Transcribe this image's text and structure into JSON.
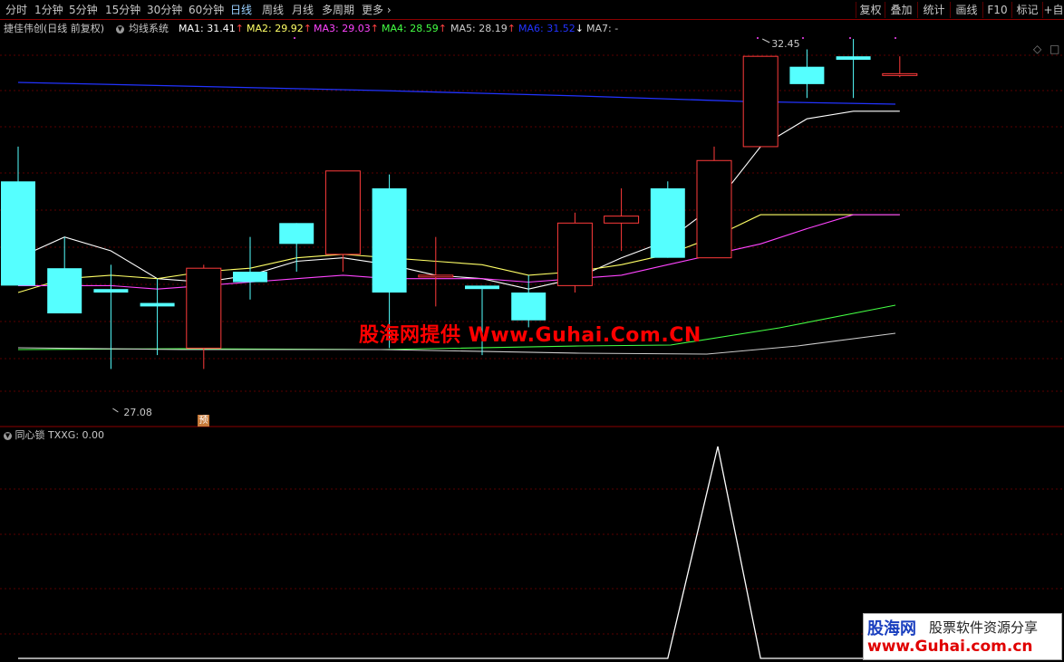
{
  "periods": [
    "分时",
    "1分钟",
    "5分钟",
    "15分钟",
    "30分钟",
    "60分钟",
    "日线",
    "周线",
    "月线",
    "多周期",
    "更多 ›"
  ],
  "active_period": "日线",
  "tools": [
    "复权",
    "叠加",
    "统计",
    "画线",
    "F10",
    "标记",
    "+自"
  ],
  "stock_name": "捷佳伟创(日线 前复权)",
  "indicator_name": "均线系统",
  "ma": [
    {
      "label": "MA1: 31.41",
      "color": "#ffffff",
      "arrow": "↑"
    },
    {
      "label": "MA2: 29.92",
      "color": "#ffff66",
      "arrow": "↑"
    },
    {
      "label": "MA3: 29.03",
      "color": "#ff44ff",
      "arrow": "↑"
    },
    {
      "label": "MA4: 28.59",
      "color": "#44ff44",
      "arrow": "↑"
    },
    {
      "label": "MA5: 28.19",
      "color": "#cccccc",
      "arrow": "↑"
    },
    {
      "label": "MA6: 31.52",
      "color": "#2233ff",
      "arrow": "↓"
    },
    {
      "label": "MA7: -",
      "color": "#cccccc",
      "arrow": ""
    }
  ],
  "price_high_label": "32.45",
  "price_low_label": "27.08",
  "pre_badge": "预",
  "sub_indicator": "同心锁",
  "sub_value": "TXXG: 0.00",
  "watermark": "股海网提供 Www.Guhai.Com.CN",
  "logo": {
    "main": "股海网",
    "slogan": "股票软件资源分享",
    "url": "www.Guhai.com.cn"
  },
  "icons": {
    "diamond": "◇",
    "close": "□",
    "collapse": "▼"
  },
  "colors": {
    "up": "#ff3b3b",
    "down": "#55ffff",
    "grid": "#5a0000",
    "border": "#8b0000"
  },
  "chart_data": {
    "type": "candlestick",
    "candles": [
      {
        "o": 30.4,
        "h": 30.9,
        "l": 28.9,
        "c": 28.9
      },
      {
        "o": 29.15,
        "h": 29.6,
        "l": 28.6,
        "c": 28.5
      },
      {
        "o": 28.85,
        "h": 29.2,
        "l": 27.7,
        "c": 28.8
      },
      {
        "o": 28.65,
        "h": 29.0,
        "l": 27.9,
        "c": 28.6
      },
      {
        "o": 28.0,
        "h": 29.2,
        "l": 27.7,
        "c": 29.15
      },
      {
        "o": 29.1,
        "h": 29.6,
        "l": 28.7,
        "c": 28.95
      },
      {
        "o": 29.8,
        "h": 29.6,
        "l": 29.1,
        "c": 29.5
      },
      {
        "o": 29.35,
        "h": 30.1,
        "l": 29.1,
        "c": 30.55
      },
      {
        "o": 30.3,
        "h": 30.5,
        "l": 28.0,
        "c": 28.8
      },
      {
        "o": 29.05,
        "h": 29.6,
        "l": 28.6,
        "c": 29.05
      },
      {
        "o": 28.9,
        "h": 28.8,
        "l": 27.9,
        "c": 28.85
      },
      {
        "o": 28.8,
        "h": 29.05,
        "l": 28.3,
        "c": 28.4
      },
      {
        "o": 28.9,
        "h": 29.95,
        "l": 28.8,
        "c": 29.8
      },
      {
        "o": 29.8,
        "h": 30.3,
        "l": 29.4,
        "c": 29.9
      },
      {
        "o": 30.3,
        "h": 30.4,
        "l": 29.3,
        "c": 29.3
      },
      {
        "o": 29.3,
        "h": 30.9,
        "l": 29.3,
        "c": 30.7
      },
      {
        "o": 30.9,
        "h": 32.2,
        "l": 30.9,
        "c": 32.2
      },
      {
        "o": 32.05,
        "h": 32.3,
        "l": 31.6,
        "c": 31.8
      },
      {
        "o": 32.2,
        "h": 32.45,
        "l": 31.6,
        "c": 32.15
      },
      {
        "o": 31.95,
        "h": 32.2,
        "l": 31.9,
        "c": 31.95
      }
    ],
    "ma_lines": [
      {
        "name": "MA1",
        "values": [
          29.3,
          29.6,
          29.4,
          29.0,
          28.95,
          29.05,
          29.25,
          29.3,
          29.2,
          29.05,
          29.0,
          28.85,
          29.0,
          29.3,
          29.55,
          30.05,
          30.9,
          31.3,
          31.41,
          31.41
        ]
      },
      {
        "name": "MA2",
        "values": [
          28.8,
          29.0,
          29.05,
          29.0,
          29.1,
          29.15,
          29.3,
          29.35,
          29.3,
          29.25,
          29.2,
          29.05,
          29.1,
          29.2,
          29.35,
          29.6,
          29.92,
          29.92,
          29.92,
          29.92
        ]
      },
      {
        "name": "MA3",
        "values": [
          28.9,
          28.9,
          28.9,
          28.85,
          28.9,
          28.95,
          29.0,
          29.05,
          29.0,
          29.0,
          29.0,
          28.95,
          29.0,
          29.05,
          29.2,
          29.35,
          29.5,
          29.72,
          29.92,
          29.92
        ]
      }
    ],
    "txxg": [
      0,
      0,
      0,
      0,
      0,
      0,
      0,
      0,
      0,
      0,
      0,
      0,
      0,
      0,
      0,
      1,
      0,
      0,
      0,
      0
    ]
  }
}
